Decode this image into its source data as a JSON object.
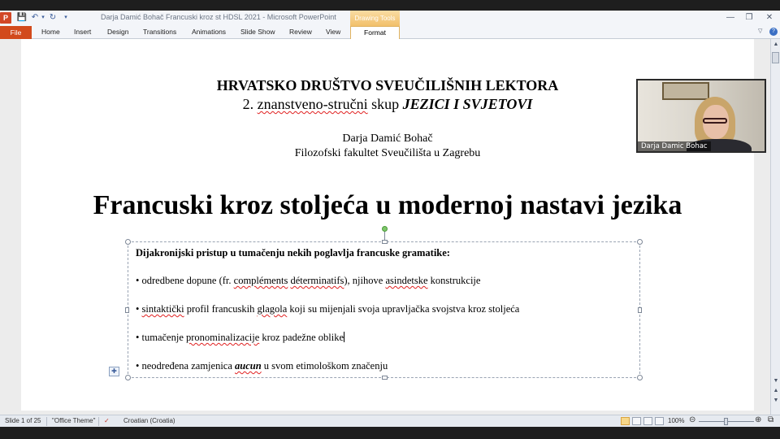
{
  "window": {
    "title": "Darja Damić Bohač Francuski kroz st HDSL 2021  -  Microsoft PowerPoint",
    "contextual_tab": "Drawing Tools",
    "app_icon": "P"
  },
  "ribbon": {
    "file": "File",
    "tabs": [
      "Home",
      "Insert",
      "Design",
      "Transitions",
      "Animations",
      "Slide Show",
      "Review",
      "View"
    ],
    "format": "Format"
  },
  "slide": {
    "org_title": "HRVATSKO DRUŠTVO SVEUČILIŠNIH LEKTORA",
    "conf_prefix": "2. ",
    "conf_word1": "znanstveno-stručni",
    "conf_word2": " skup  ",
    "conf_name": "JEZICI I SVJETOVI",
    "author": "Darja Damić Bohač",
    "affiliation": "Filozofski fakultet Sveučilišta  u Zagrebu",
    "main_title": "Francuski kroz stoljeća u modernoj nastavi jezika"
  },
  "textbox": {
    "heading": "Dijakronijski pristup u tumačenju nekih poglavlja francuske gramatike:",
    "b1_a": "• odredbene dopune (fr. ",
    "b1_squig1": "compléments",
    "b1_space": " ",
    "b1_squig2": "déterminatifs",
    "b1_b": "),  njihove  ",
    "b1_squig3": "asindetske",
    "b1_c": " konstrukcije",
    "b2_a": "• ",
    "b2_squig1": "sintaktički",
    "b2_b": "  profil francuskih  ",
    "b2_squig2": "glagola",
    "b2_c": "  koji su mijenjali  svoja upravljačka  svojstva kroz stoljeća",
    "b3_a": "• tumačenje  ",
    "b3_squig1": "pronominalizacije",
    "b3_b": "  kroz padežne oblike",
    "b4_a": "• neodređena zamjenica  ",
    "b4_aucun": "aucun",
    "b4_b": " u svom etimološkom značenju"
  },
  "webcam": {
    "participant_name": "Darja Damic Bohac"
  },
  "status": {
    "slide_info": "Slide 1 of 25",
    "theme": "\"Office Theme\"",
    "language": "Croatian (Croatia)",
    "zoom": "100%"
  },
  "icons": {
    "save": "save-icon",
    "undo": "undo-icon",
    "redo": "redo-icon",
    "minimize": "minimize-icon",
    "restore": "restore-icon",
    "close": "close-icon",
    "help": "help-icon",
    "paste_options": "paste-options-icon"
  }
}
